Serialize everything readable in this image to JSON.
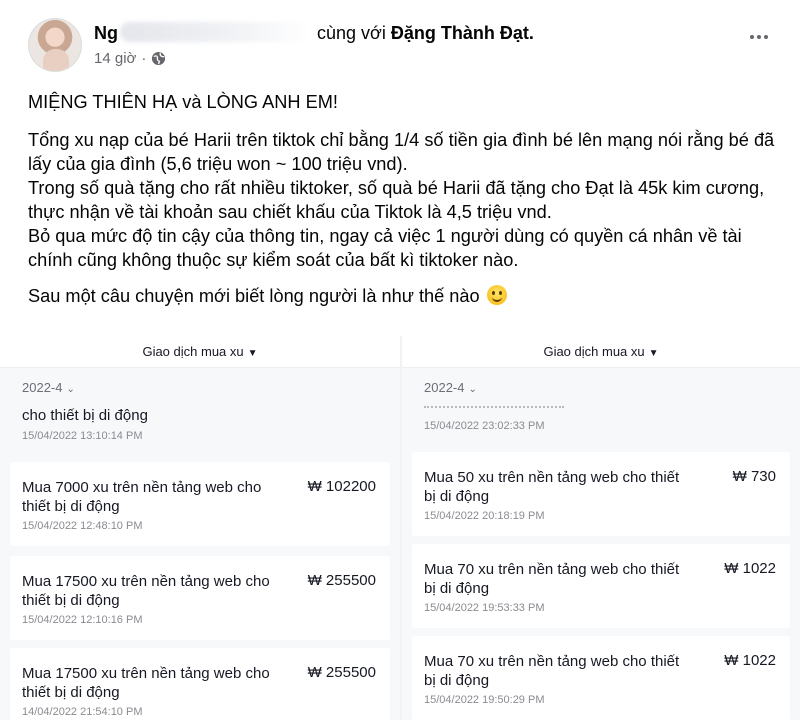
{
  "post": {
    "author_prefix": "Ng",
    "with_text": "cùng với",
    "tagged_name": "Đặng Thành Đạt.",
    "time": "14 giờ",
    "separator": "·",
    "more_icon": "more-horizontal-icon",
    "paragraphs": [
      "MIỆNG THIÊN HẠ và LÒNG ANH EM!",
      "Tổng xu nạp của bé Harii trên tiktok chỉ bằng 1/4 số tiền gia đình bé lên mạng nói rằng bé đã lấy của gia đình (5,6 triệu won ~ 100 triệu vnd).\nTrong số quà tặng cho rất nhiều tiktoker, số quà bé Harii đã tặng cho Đạt là 45k kim cương, thực nhận về tài khoản sau chiết khấu của Tiktok là 4,5 triệu vnd.\nBỏ qua mức độ tin cậy của thông tin, ngay cả việc 1 người dùng có quyền cá nhân về tài chính cũng không thuộc sự kiểm soát của bất kì tiktoker nào.",
      "Sau một câu chuyện mới biết lòng người là như thế nào"
    ]
  },
  "screenshots": {
    "left": {
      "header": "Giao dịch mua xu",
      "month": "2022-4",
      "partial": {
        "title": "cho thiết bị di động",
        "date": "15/04/2022 13:10:14 PM"
      },
      "items": [
        {
          "title": "Mua 7000 xu trên nền tảng web cho thiết bị di động",
          "amount": "₩ 102200",
          "date": "15/04/2022 12:48:10 PM"
        },
        {
          "title": "Mua 17500 xu trên nền tảng web cho thiết bị di động",
          "amount": "₩ 255500",
          "date": "15/04/2022 12:10:16 PM"
        },
        {
          "title": "Mua 17500 xu trên nền tảng web cho thiết bị di động",
          "amount": "₩ 255500",
          "date": "14/04/2022 21:54:10 PM"
        }
      ]
    },
    "right": {
      "header": "Giao dịch mua xu",
      "month": "2022-4",
      "partial": {
        "date": "15/04/2022 23:02:33 PM"
      },
      "items": [
        {
          "title": "Mua 50 xu trên nền tảng web cho thiết bị di động",
          "amount": "₩ 730",
          "date": "15/04/2022 20:18:19 PM"
        },
        {
          "title": "Mua 70 xu trên nền tảng web cho thiết bị di động",
          "amount": "₩ 1022",
          "date": "15/04/2022 19:53:33 PM"
        },
        {
          "title": "Mua 70 xu trên nền tảng web cho thiết bị di động",
          "amount": "₩ 1022",
          "date": "15/04/2022 19:50:29 PM"
        }
      ]
    }
  }
}
